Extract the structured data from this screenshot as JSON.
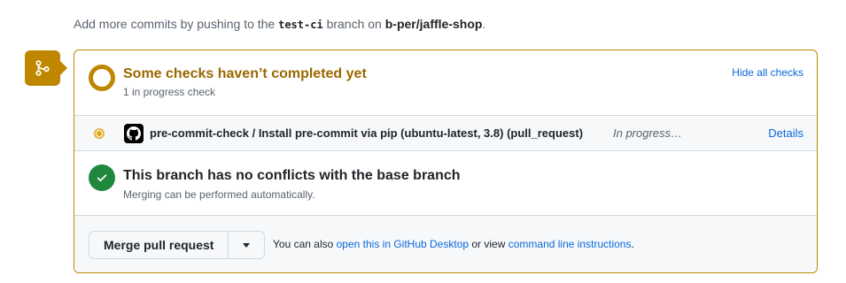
{
  "intro": {
    "prefix": "Add more commits by pushing to the ",
    "branch": "test-ci",
    "middle": " branch on ",
    "repo": "b-per/jaffle-shop",
    "suffix": "."
  },
  "checks": {
    "title": "Some checks haven’t completed yet",
    "subtitle": "1 in progress check",
    "hide_label": "Hide all checks"
  },
  "run": {
    "name": "pre-commit-check / Install pre-commit via pip (ubuntu-latest, 3.8) (pull_request)",
    "status": "In progress…",
    "details_label": "Details"
  },
  "conflicts": {
    "title": "This branch has no conflicts with the base branch",
    "subtitle": "Merging can be performed automatically."
  },
  "merge": {
    "button_label": "Merge pull request",
    "hint_prefix": "You can also ",
    "desktop_link": "open this in GitHub Desktop",
    "hint_middle": " or view ",
    "cli_link": "command line instructions",
    "hint_suffix": "."
  },
  "colors": {
    "pending": "#bf8700",
    "success": "#1f883d",
    "link": "#0969da"
  },
  "icons": {
    "merge": "git-merge-icon",
    "pending": "pending-ring-icon",
    "run_status": "in-progress-dot-icon",
    "avatar": "github-mark-icon",
    "success": "check-circle-icon",
    "caret": "triangle-down-icon"
  }
}
